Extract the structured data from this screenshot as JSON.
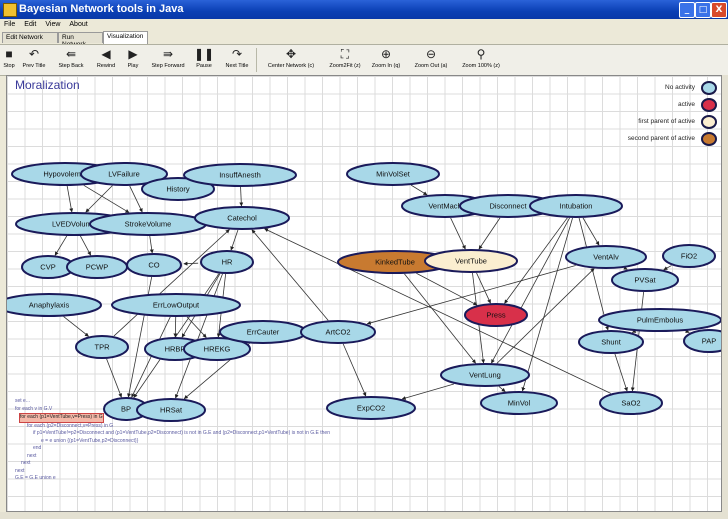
{
  "window": {
    "title": "Bayesian Network tools in Java",
    "buttons": [
      "_",
      "□",
      "X"
    ]
  },
  "menu": [
    "File",
    "Edit",
    "View",
    "About"
  ],
  "tabs": [
    {
      "label": "Edit Network",
      "active": false
    },
    {
      "label": "Run Network",
      "active": false
    },
    {
      "label": "Visualization",
      "active": true
    }
  ],
  "toolbar": [
    {
      "label": "Stop",
      "icon": "stop-icon",
      "glyph": "■"
    },
    {
      "label": "Prev Title",
      "icon": "undo-icon",
      "glyph": "↶"
    },
    {
      "label": "Step Back",
      "icon": "step-back-icon",
      "glyph": "⇚"
    },
    {
      "label": "Rewind",
      "icon": "rewind-icon",
      "glyph": "◀"
    },
    {
      "label": "Play",
      "icon": "play-icon",
      "glyph": "▶"
    },
    {
      "label": "Step Forward",
      "icon": "step-forward-icon",
      "glyph": "⇛"
    },
    {
      "label": "Pause",
      "icon": "pause-icon",
      "glyph": "❚❚"
    },
    {
      "label": "Next Title",
      "icon": "redo-icon",
      "glyph": "↷"
    },
    {
      "label": "Center Network (c)",
      "icon": "center-icon",
      "glyph": "✥"
    },
    {
      "label": "Zoom2Fit (z)",
      "icon": "zoom-fit-icon",
      "glyph": "⛶"
    },
    {
      "label": "Zoom In (q)",
      "icon": "zoom-in-icon",
      "glyph": "⊕"
    },
    {
      "label": "Zoom Out (a)",
      "icon": "zoom-out-icon",
      "glyph": "⊖"
    },
    {
      "label": "Zoom 100% (z)",
      "icon": "zoom-100-icon",
      "glyph": "⚲"
    }
  ],
  "view": {
    "heading": "Moralization",
    "legend": [
      {
        "label": "No activity",
        "color": "#a8d8e8"
      },
      {
        "label": "active",
        "color": "#d8304a"
      },
      {
        "label": "first parent of active",
        "color": "#fbeed0"
      },
      {
        "label": "second parent of active",
        "color": "#c87a30"
      }
    ]
  },
  "colors": {
    "normal": "#a8d8e8",
    "active": "#d8304a",
    "first_parent": "#fbeed0",
    "second_parent": "#c87a30"
  },
  "graph": {
    "nodes": [
      {
        "id": "Hypovolemia",
        "label": "Hypovolemia",
        "state": "normal"
      },
      {
        "id": "LVFailure",
        "label": "LVFailure",
        "state": "normal"
      },
      {
        "id": "History",
        "label": "History",
        "state": "normal"
      },
      {
        "id": "InsuffAnesth",
        "label": "InsuffAnesth",
        "state": "normal"
      },
      {
        "id": "LVEDVolume",
        "label": "LVEDVolume",
        "state": "normal"
      },
      {
        "id": "StrokeVolume",
        "label": "StrokeVolume",
        "state": "normal"
      },
      {
        "id": "Catechol",
        "label": "Catechol",
        "state": "normal"
      },
      {
        "id": "CVP",
        "label": "CVP",
        "state": "normal"
      },
      {
        "id": "PCWP",
        "label": "PCWP",
        "state": "normal"
      },
      {
        "id": "CO",
        "label": "CO",
        "state": "normal"
      },
      {
        "id": "HR",
        "label": "HR",
        "state": "normal"
      },
      {
        "id": "Anaphylaxis",
        "label": "Anaphylaxis",
        "state": "normal"
      },
      {
        "id": "ErrLowOutput",
        "label": "ErrLowOutput",
        "state": "normal"
      },
      {
        "id": "TPR",
        "label": "TPR",
        "state": "normal"
      },
      {
        "id": "HRBP",
        "label": "HRBP",
        "state": "normal"
      },
      {
        "id": "HREKG",
        "label": "HREKG",
        "state": "normal"
      },
      {
        "id": "ErrCauter",
        "label": "ErrCauter",
        "state": "normal"
      },
      {
        "id": "BP",
        "label": "BP",
        "state": "normal"
      },
      {
        "id": "HRSat",
        "label": "HRSat",
        "state": "normal"
      },
      {
        "id": "MinVolSet",
        "label": "MinVolSet",
        "state": "normal"
      },
      {
        "id": "VentMach",
        "label": "VentMach",
        "state": "normal"
      },
      {
        "id": "Disconnect",
        "label": "Disconnect",
        "state": "normal"
      },
      {
        "id": "Intubation",
        "label": "Intubation",
        "state": "normal"
      },
      {
        "id": "KinkedTube",
        "label": "KinkedTube",
        "state": "second_parent"
      },
      {
        "id": "VentTube",
        "label": "VentTube",
        "state": "first_parent"
      },
      {
        "id": "VentAlv",
        "label": "VentAlv",
        "state": "normal"
      },
      {
        "id": "FiO2",
        "label": "FiO2",
        "state": "normal"
      },
      {
        "id": "PVSat",
        "label": "PVSat",
        "state": "normal"
      },
      {
        "id": "Press",
        "label": "Press",
        "state": "active"
      },
      {
        "id": "ArtCO2",
        "label": "ArtCO2",
        "state": "normal"
      },
      {
        "id": "PulmEmbolus",
        "label": "PulmEmbolus",
        "state": "normal"
      },
      {
        "id": "Shunt",
        "label": "Shunt",
        "state": "normal"
      },
      {
        "id": "PAP",
        "label": "PAP",
        "state": "normal"
      },
      {
        "id": "VentLung",
        "label": "VentLung",
        "state": "normal"
      },
      {
        "id": "MinVol",
        "label": "MinVol",
        "state": "normal"
      },
      {
        "id": "ExpCO2",
        "label": "ExpCO2",
        "state": "normal"
      },
      {
        "id": "SaO2",
        "label": "SaO2",
        "state": "normal"
      }
    ],
    "edges": [
      [
        "Hypovolemia",
        "LVEDVolume"
      ],
      [
        "Hypovolemia",
        "StrokeVolume"
      ],
      [
        "LVFailure",
        "LVEDVolume"
      ],
      [
        "LVFailure",
        "StrokeVolume"
      ],
      [
        "LVFailure",
        "History"
      ],
      [
        "InsuffAnesth",
        "Catechol"
      ],
      [
        "LVEDVolume",
        "CVP"
      ],
      [
        "LVEDVolume",
        "PCWP"
      ],
      [
        "StrokeVolume",
        "CO"
      ],
      [
        "Catechol",
        "HR"
      ],
      [
        "HR",
        "CO"
      ],
      [
        "HR",
        "HRBP"
      ],
      [
        "HR",
        "HREKG"
      ],
      [
        "HR",
        "HRSat"
      ],
      [
        "HR",
        "BP"
      ],
      [
        "Anaphylaxis",
        "TPR"
      ],
      [
        "ErrLowOutput",
        "HRBP"
      ],
      [
        "ErrLowOutput",
        "HREKG"
      ],
      [
        "ErrCauter",
        "HREKG"
      ],
      [
        "ErrCauter",
        "HRSat"
      ],
      [
        "TPR",
        "BP"
      ],
      [
        "TPR",
        "Catechol"
      ],
      [
        "CO",
        "BP"
      ],
      [
        "ErrLowOutput",
        "BP"
      ],
      [
        "MinVolSet",
        "VentMach"
      ],
      [
        "VentMach",
        "VentTube"
      ],
      [
        "Disconnect",
        "VentTube"
      ],
      [
        "Intubation",
        "VentAlv"
      ],
      [
        "Intubation",
        "Shunt"
      ],
      [
        "Intubation",
        "Press"
      ],
      [
        "Intubation",
        "VentLung"
      ],
      [
        "Intubation",
        "MinVol"
      ],
      [
        "KinkedTube",
        "Press"
      ],
      [
        "KinkedTube",
        "VentLung"
      ],
      [
        "VentTube",
        "Press"
      ],
      [
        "VentTube",
        "VentLung"
      ],
      [
        "VentAlv",
        "PVSat"
      ],
      [
        "VentAlv",
        "ArtCO2"
      ],
      [
        "FiO2",
        "PVSat"
      ],
      [
        "PVSat",
        "SaO2"
      ],
      [
        "Shunt",
        "SaO2"
      ],
      [
        "PulmEmbolus",
        "Shunt"
      ],
      [
        "PulmEmbolus",
        "PAP"
      ],
      [
        "ArtCO2",
        "Catechol"
      ],
      [
        "ArtCO2",
        "ExpCO2"
      ],
      [
        "VentLung",
        "ExpCO2"
      ],
      [
        "VentLung",
        "MinVol"
      ],
      [
        "VentLung",
        "VentAlv"
      ],
      [
        "SaO2",
        "Catechol"
      ]
    ]
  },
  "pseudocode": [
    "set e...",
    "for each v in G.V",
    "for each (p1=VentTube,v=Press) in G",
    "for each (p2=Disconnect,v=Press) in G",
    "if p1=VentTube!=p2=Disconnect and (p1=VentTube,p2=Disconnect) is not in G.E and (p2=Disconnect,p1=VentTube) is not in G.E then",
    "e = e union {(p1=VentTube,p2=Disconnect)}",
    "end",
    "next",
    "next",
    "next",
    "G.E = G.E union e"
  ]
}
